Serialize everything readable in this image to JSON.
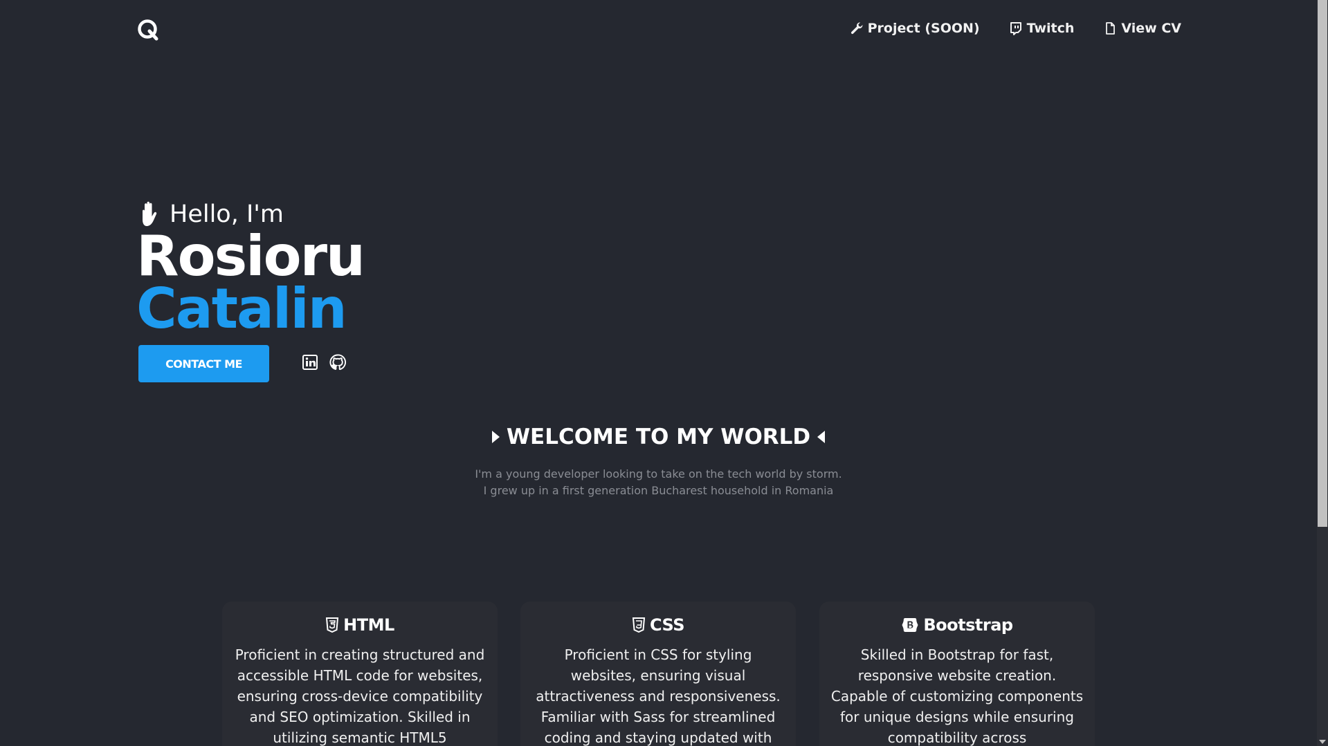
{
  "header": {
    "logo_icon": "q-logo-icon",
    "nav": [
      {
        "label": "Project (SOON)",
        "icon": "wrench-icon"
      },
      {
        "label": "Twitch",
        "icon": "twitch-icon"
      },
      {
        "label": "View CV",
        "icon": "file-icon"
      }
    ]
  },
  "hero": {
    "greeting": "Hello, I'm",
    "greeting_icon": "hand-wave-icon",
    "first_name": "Rosioru",
    "last_name": "Catalin",
    "contact_label": "CONTACT ME",
    "social": [
      {
        "name": "linkedin-icon"
      },
      {
        "name": "github-icon"
      }
    ]
  },
  "welcome": {
    "title": "WELCOME TO MY WORLD",
    "intro_line1": "I'm a young developer looking to take on the tech world by storm.",
    "intro_line2": "I grew up in a first generation Bucharest household in Romania"
  },
  "skills": [
    {
      "title": "HTML",
      "icon": "html5-icon",
      "text": "Proficient in creating structured and accessible HTML code for websites, ensuring cross-device compatibility and SEO optimization. Skilled in utilizing semantic HTML5"
    },
    {
      "title": "CSS",
      "icon": "css3-icon",
      "text": "Proficient in CSS for styling websites, ensuring visual attractiveness and responsiveness. Familiar with Sass for streamlined coding and staying updated with"
    },
    {
      "title": "Bootstrap",
      "icon": "bootstrap-icon",
      "text": "Skilled in Bootstrap for fast, responsive website creation. Capable of customizing components for unique designs while ensuring compatibility across"
    }
  ],
  "colors": {
    "background": "#252830",
    "accent": "#1d9bf0",
    "card": "#2a2c33",
    "muted_text": "#8a8d94"
  }
}
